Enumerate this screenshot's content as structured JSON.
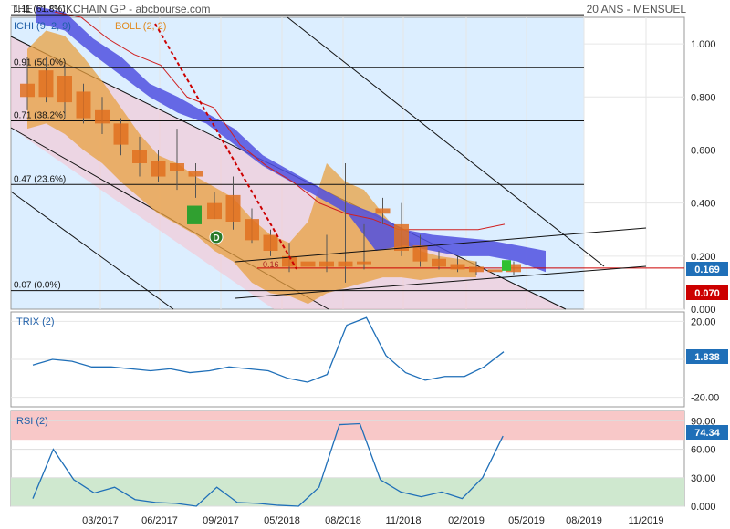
{
  "header": {
    "title": "THE BLOCKCHAIN GP - abcbourse.com",
    "period": "20 ANS - MENSUEL"
  },
  "legend": {
    "ichimoku": "ICHI (9, 2, 9)",
    "boll": "BOLL (2, 2)"
  },
  "colors": {
    "candle": "#e07020",
    "bollinger_fill": "#e8a040",
    "cloud": "#5050e0",
    "price_tag": "#1f6fb8",
    "low_tag": "#cc0000",
    "trix_line": "#1f6fb8",
    "rsi_line": "#1f6fb8",
    "rsi_over": "#f8c8c8",
    "rsi_under": "#cfe8cf",
    "bg_panel": "#dceeff"
  },
  "chart_data": [
    {
      "type": "candlestick",
      "panel": "price",
      "ylim": [
        0,
        1.1
      ],
      "y_ticks": [
        "1.000",
        "0.800",
        "0.600",
        "0.400",
        "0.200",
        "0.000"
      ],
      "x_ticks": [
        "03/2017",
        "06/2017",
        "09/2017",
        "05/2018",
        "08/2018",
        "11/2018",
        "02/2019",
        "05/2019",
        "08/2019",
        "11/2019"
      ],
      "fibonacci": [
        {
          "label": "1.11 (61.8%)",
          "value": 1.11
        },
        {
          "label": "0.91 (50.0%)",
          "value": 0.91
        },
        {
          "label": "0.71 (38.2%)",
          "value": 0.71
        },
        {
          "label": "0.47 (23.6%)",
          "value": 0.47
        },
        {
          "label": "0.07 (0.0%)",
          "value": 0.07
        }
      ],
      "last_price": "0.169",
      "low_level": "0.070",
      "marker_label": "D",
      "line_label": "0.16",
      "candles": [
        {
          "o": 0.85,
          "h": 0.95,
          "l": 0.75,
          "c": 0.8
        },
        {
          "o": 0.8,
          "h": 0.95,
          "l": 0.78,
          "c": 0.9
        },
        {
          "o": 0.88,
          "h": 0.92,
          "l": 0.72,
          "c": 0.78
        },
        {
          "o": 0.82,
          "h": 0.85,
          "l": 0.7,
          "c": 0.72
        },
        {
          "o": 0.75,
          "h": 0.8,
          "l": 0.66,
          "c": 0.7
        },
        {
          "o": 0.7,
          "h": 0.72,
          "l": 0.58,
          "c": 0.62
        },
        {
          "o": 0.6,
          "h": 0.65,
          "l": 0.5,
          "c": 0.55
        },
        {
          "o": 0.56,
          "h": 0.6,
          "l": 0.48,
          "c": 0.5
        },
        {
          "o": 0.52,
          "h": 0.68,
          "l": 0.45,
          "c": 0.55
        },
        {
          "o": 0.5,
          "h": 0.55,
          "l": 0.42,
          "c": 0.52
        },
        {
          "o": 0.4,
          "h": 0.44,
          "l": 0.34,
          "c": 0.34
        },
        {
          "o": 0.43,
          "h": 0.5,
          "l": 0.3,
          "c": 0.33
        },
        {
          "o": 0.34,
          "h": 0.38,
          "l": 0.25,
          "c": 0.26
        },
        {
          "o": 0.28,
          "h": 0.3,
          "l": 0.2,
          "c": 0.22
        },
        {
          "o": 0.2,
          "h": 0.25,
          "l": 0.14,
          "c": 0.16
        },
        {
          "o": 0.18,
          "h": 0.2,
          "l": 0.14,
          "c": 0.16
        },
        {
          "o": 0.18,
          "h": 0.28,
          "l": 0.14,
          "c": 0.16
        },
        {
          "o": 0.16,
          "h": 0.55,
          "l": 0.1,
          "c": 0.18
        },
        {
          "o": 0.18,
          "h": 0.32,
          "l": 0.15,
          "c": 0.17
        },
        {
          "o": 0.38,
          "h": 0.42,
          "l": 0.32,
          "c": 0.36
        },
        {
          "o": 0.32,
          "h": 0.4,
          "l": 0.2,
          "c": 0.22
        },
        {
          "o": 0.24,
          "h": 0.28,
          "l": 0.16,
          "c": 0.18
        },
        {
          "o": 0.19,
          "h": 0.22,
          "l": 0.15,
          "c": 0.16
        },
        {
          "o": 0.17,
          "h": 0.2,
          "l": 0.14,
          "c": 0.15
        },
        {
          "o": 0.16,
          "h": 0.18,
          "l": 0.13,
          "c": 0.14
        },
        {
          "o": 0.15,
          "h": 0.17,
          "l": 0.13,
          "c": 0.14
        },
        {
          "o": 0.14,
          "h": 0.18,
          "l": 0.13,
          "c": 0.17
        }
      ]
    },
    {
      "type": "line",
      "panel": "trix",
      "title": "TRIX (2)",
      "ylim": [
        -25,
        25
      ],
      "y_ticks": [
        "20.00",
        "0.000",
        "-20.00"
      ],
      "last_value": "1.838",
      "values": [
        -3,
        0,
        -1,
        -4,
        -4,
        -5,
        -6,
        -5,
        -7,
        -6,
        -4,
        -5,
        -6,
        -10,
        -12,
        -8,
        18,
        22,
        2,
        -7,
        -11,
        -9,
        -9,
        -4,
        4
      ]
    },
    {
      "type": "line",
      "panel": "rsi",
      "title": "RSI (2)",
      "ylim": [
        0,
        100
      ],
      "y_ticks": [
        "90.00",
        "60.00",
        "30.00",
        "0.000"
      ],
      "bands": {
        "over": 70,
        "under": 30
      },
      "last_value": "74.34",
      "values": [
        8,
        60,
        28,
        14,
        20,
        7,
        4,
        3,
        0,
        20,
        4,
        3,
        1,
        0,
        20,
        86,
        87,
        28,
        15,
        10,
        15,
        8,
        30,
        74
      ]
    }
  ]
}
